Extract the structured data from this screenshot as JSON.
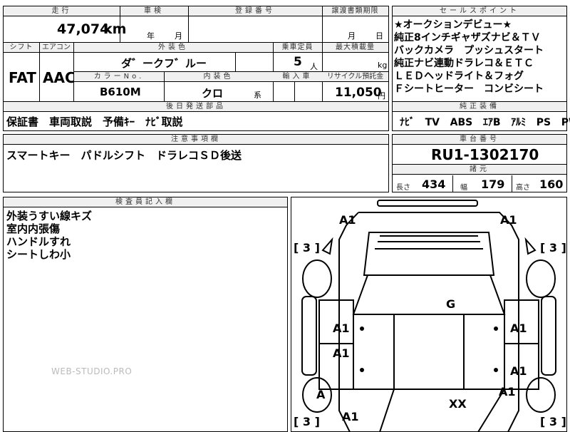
{
  "top": {
    "mileage_label": "走行",
    "mileage_value": "47,074",
    "mileage_unit": "km",
    "inspection_label": "車検",
    "inspection_year": "年",
    "inspection_month": "月",
    "registration_label": "登録番号",
    "transfer_label": "譲渡書類期限",
    "transfer_month": "月",
    "transfer_day": "日",
    "shift_label": "シフト",
    "shift_value": "FAT",
    "ac_label": "エアコン",
    "ac_value": "AAC",
    "exterior_label": "外装色",
    "exterior_value": "ダ゛ークフ゛ルー",
    "capacity_label": "乗車定員",
    "capacity_value": "5",
    "capacity_unit": "人",
    "maxload_label": "最大積載量",
    "maxload_unit": "kg",
    "colorno_label": "カラーNo.",
    "colorno_value": "B610M",
    "interior_label": "内装色",
    "interior_value": "クロ",
    "interior_suffix": "系",
    "import_label": "輸入車",
    "recycle_label": "リサイクル預託金",
    "recycle_value": "11,050",
    "recycle_unit": "円"
  },
  "sales_points": {
    "title": "セールスポイント",
    "lines": [
      "★オークションデビュー★",
      "純正8インチギャザズナビ＆ＴＶ",
      "バックカメラ　プッシュスタート",
      "純正ナビ連動ドラレコ＆ＥＴＣ",
      "ＬＥＤヘッドライト＆フォグ",
      "Ｆシートヒーター　コンビシート"
    ]
  },
  "later_parts": {
    "title": "後日発送部品",
    "value": "保証書　車両取説　予備ｷｰ　ﾅﾋﾞ取説"
  },
  "genuine_equipment": {
    "title": "純正装備",
    "items": [
      "ﾅﾋﾞ",
      "TV",
      "ABS",
      "ｴｱB",
      "ｱﾙﾐ",
      "PS",
      "PW"
    ]
  },
  "notes": {
    "title": "注意事項欄",
    "value": "スマートキー　パドルシフト　ドラレコＳＤ後送"
  },
  "chassis": {
    "title": "車台番号",
    "value": "RU1-1302170",
    "dims_title": "諸元",
    "length_label": "長さ",
    "length_value": "434",
    "width_label": "幅",
    "width_value": "179",
    "height_label": "高さ",
    "height_value": "160"
  },
  "inspector": {
    "title": "検査員記入欄",
    "lines": [
      "外装うすい線キズ",
      "室内内張傷",
      "ハンドルすれ",
      "シートしわ小"
    ]
  },
  "diagram": {
    "marks": {
      "a1_front_left": "A1",
      "a1_front_right": "A1",
      "g_roof": "G",
      "a1_door_fl": "A1",
      "a1_door_fr": "A1",
      "a1_door_rl": "A1",
      "a1_door_rr": "A1",
      "a_wheel_rl": "A",
      "a1_rear_right": "A1",
      "xx_rear": "XX",
      "a1_rear_left": "A1",
      "tire_fl": "[ 3 ]",
      "tire_fr": "[ 3 ]",
      "tire_rl": "[ 3 ]",
      "tire_rr": "[ 3 ]"
    }
  },
  "watermark": "WEB-STUDIO.PRO"
}
